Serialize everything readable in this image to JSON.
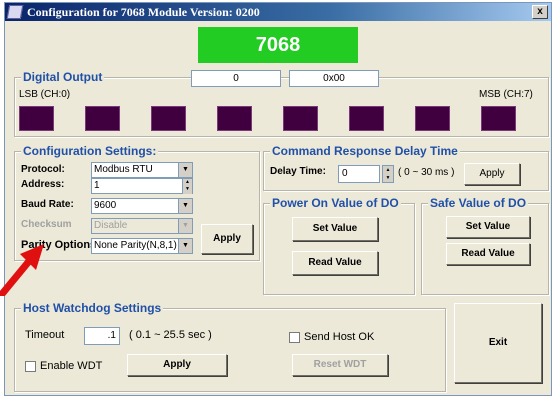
{
  "window": {
    "title": "Configuration for 7068 Module Version: 0200",
    "close_label": "x"
  },
  "module_name": "7068",
  "digital_output": {
    "legend": "Digital Output",
    "value_dec": "0",
    "value_hex": "0x00",
    "lsb_label": "LSB (CH:0)",
    "msb_label": "MSB (CH:7)",
    "led_color": "#400040"
  },
  "config": {
    "legend": "Configuration Settings:",
    "protocol_label": "Protocol:",
    "protocol_value": "Modbus RTU",
    "address_label": "Address:",
    "address_value": "1",
    "baud_label": "Baud Rate:",
    "baud_value": "9600",
    "checksum_label": "Checksum",
    "checksum_value": "Disable",
    "parity_label": "Parity Options",
    "parity_value": "None Parity(N,8,1)",
    "apply_label": "Apply"
  },
  "command_response": {
    "legend": "Command Response Delay Time",
    "delay_label": "Delay Time:",
    "delay_value": "0",
    "range_label": "( 0 ~ 30 ms )",
    "apply_label": "Apply"
  },
  "power_on": {
    "legend": "Power On Value of DO",
    "set_label": "Set Value",
    "read_label": "Read Value"
  },
  "safe_value": {
    "legend": "Safe Value of DO",
    "set_label": "Set Value",
    "read_label": "Read Value"
  },
  "watchdog": {
    "legend": "Host Watchdog Settings",
    "timeout_label": "Timeout",
    "timeout_value": ".1",
    "range_label": "( 0.1 ~ 25.5 sec )",
    "send_host_ok_label": "Send Host OK",
    "enable_wdt_label": "Enable WDT",
    "apply_label": "Apply",
    "reset_label": "Reset WDT"
  },
  "exit_label": "Exit",
  "colors": {
    "legend_blue": "#2050a8",
    "module_green": "#22cc22",
    "annotation_red": "#e01010"
  }
}
